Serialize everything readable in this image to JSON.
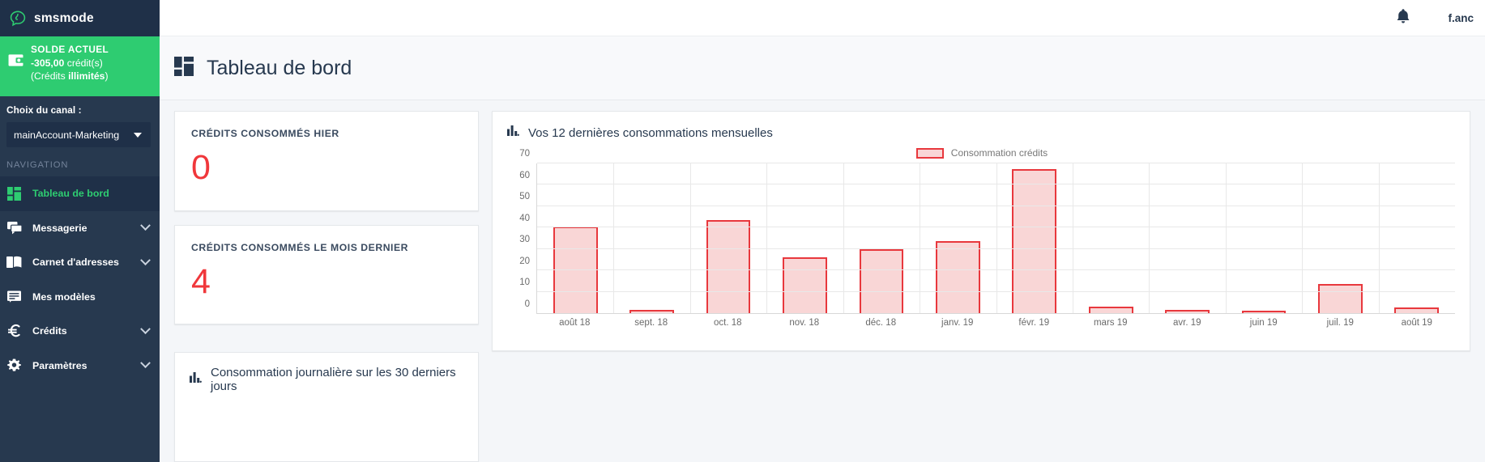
{
  "sidebar": {
    "brand": {
      "name": "smsmode",
      "logo_icon": "speech-bubble-logo"
    },
    "balance": {
      "title": "SOLDE ACTUEL",
      "amount": "-305,00",
      "amount_unit": "crédit(s)",
      "sub_prefix": "(Crédits ",
      "sub_bold": "illimités",
      "sub_suffix": ")",
      "icon": "wallet-icon",
      "bg_color": "#2ecc71"
    },
    "channel": {
      "label": "Choix du canal :",
      "selected": "mainAccount-Marketing",
      "caret_icon": "caret-down-icon"
    },
    "nav_heading": "NAVIGATION",
    "items": [
      {
        "label": "Tableau de bord",
        "icon": "dashboard-grid-icon",
        "active": true,
        "expandable": false
      },
      {
        "label": "Messagerie",
        "icon": "chat-bubbles-icon",
        "active": false,
        "expandable": true
      },
      {
        "label": "Carnet d'adresses",
        "icon": "address-book-icon",
        "active": false,
        "expandable": true
      },
      {
        "label": "Mes modèles",
        "icon": "template-lines-icon",
        "active": false,
        "expandable": false
      },
      {
        "label": "Crédits",
        "icon": "euro-icon",
        "active": false,
        "expandable": true
      },
      {
        "label": "Paramètres",
        "icon": "gear-icon",
        "active": false,
        "expandable": true
      }
    ]
  },
  "topbar": {
    "bell_icon": "notification-bell-icon",
    "user": "f.anc"
  },
  "page": {
    "title": "Tableau de bord",
    "title_icon": "dashboard-grid-icon"
  },
  "stats": [
    {
      "label": "CRÉDITS CONSOMMÉS HIER",
      "value": "0"
    },
    {
      "label": "CRÉDITS CONSOMMÉS LE MOIS DERNIER",
      "value": "4"
    }
  ],
  "monthly_card": {
    "title": "Vos 12 dernières consommations mensuelles",
    "icon": "bar-chart-icon"
  },
  "daily_card": {
    "title": "Consommation journalière sur les 30 derniers jours",
    "icon": "bar-chart-icon"
  },
  "colors": {
    "accent_green": "#2ecc71",
    "sidebar_dark": "#27394f",
    "sidebar_darker": "#1f3048",
    "chart_red_stroke": "#e8383d",
    "chart_red_fill": "#f9d6d6",
    "stat_value_red": "#f0373b"
  },
  "chart_data": {
    "type": "bar",
    "title": "Vos 12 dernières consommations mensuelles",
    "xlabel": "",
    "ylabel": "",
    "ylim": [
      0,
      70
    ],
    "yticks": [
      0,
      10,
      20,
      30,
      40,
      50,
      60,
      70
    ],
    "grid": true,
    "legend_position": "top-right",
    "legend": [
      "Consommation crédits"
    ],
    "categories": [
      "août 18",
      "sept. 18",
      "oct. 18",
      "nov. 18",
      "déc. 18",
      "janv. 19",
      "févr. 19",
      "mars 19",
      "avr. 19",
      "juin 19",
      "juil. 19",
      "août 19"
    ],
    "series": [
      {
        "name": "Consommation crédits",
        "values": [
          40.5,
          1.5,
          43.5,
          26,
          30,
          33.5,
          67.5,
          3,
          1.5,
          1,
          13.5,
          2.5
        ]
      }
    ]
  }
}
